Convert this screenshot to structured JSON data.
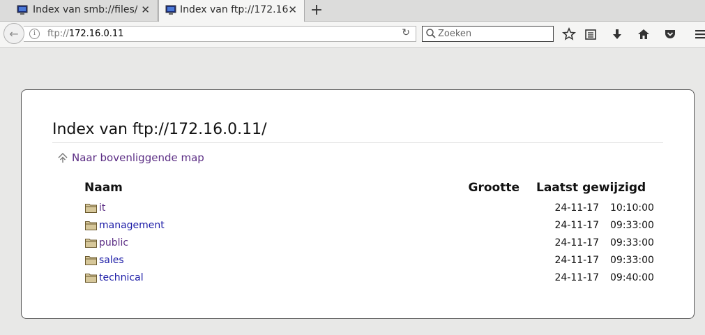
{
  "tabs": [
    {
      "title": "Index van smb://files/",
      "active": false
    },
    {
      "title": "Index van ftp://172.16...",
      "active": true
    }
  ],
  "navbar": {
    "url_scheme": "ftp://",
    "url_host": "172.16.0.11",
    "search_placeholder": "Zoeken"
  },
  "page": {
    "heading": "Index van ftp://172.16.0.11/",
    "up_link": "Naar bovenliggende map",
    "columns": {
      "name": "Naam",
      "size": "Grootte",
      "modified": "Laatst gewijzigd"
    },
    "entries": [
      {
        "name": "it",
        "date": "24-11-17",
        "time": "10:10:00",
        "visited": true
      },
      {
        "name": "management",
        "date": "24-11-17",
        "time": "09:33:00",
        "visited": false
      },
      {
        "name": "public",
        "date": "24-11-17",
        "time": "09:33:00",
        "visited": true
      },
      {
        "name": "sales",
        "date": "24-11-17",
        "time": "09:33:00",
        "visited": false
      },
      {
        "name": "technical",
        "date": "24-11-17",
        "time": "09:40:00",
        "visited": false
      }
    ]
  },
  "colors": {
    "link": "#1a1aa6",
    "visited_link": "#5b2d84",
    "background": "#e8e8e7"
  },
  "icons": [
    "monitor-icon",
    "close-icon",
    "plus-icon",
    "back-arrow-icon",
    "info-icon",
    "reload-icon",
    "search-icon",
    "star-icon",
    "reading-list-icon",
    "download-icon",
    "home-icon",
    "pocket-icon",
    "menu-icon",
    "up-arrow-icon",
    "folder-icon"
  ]
}
